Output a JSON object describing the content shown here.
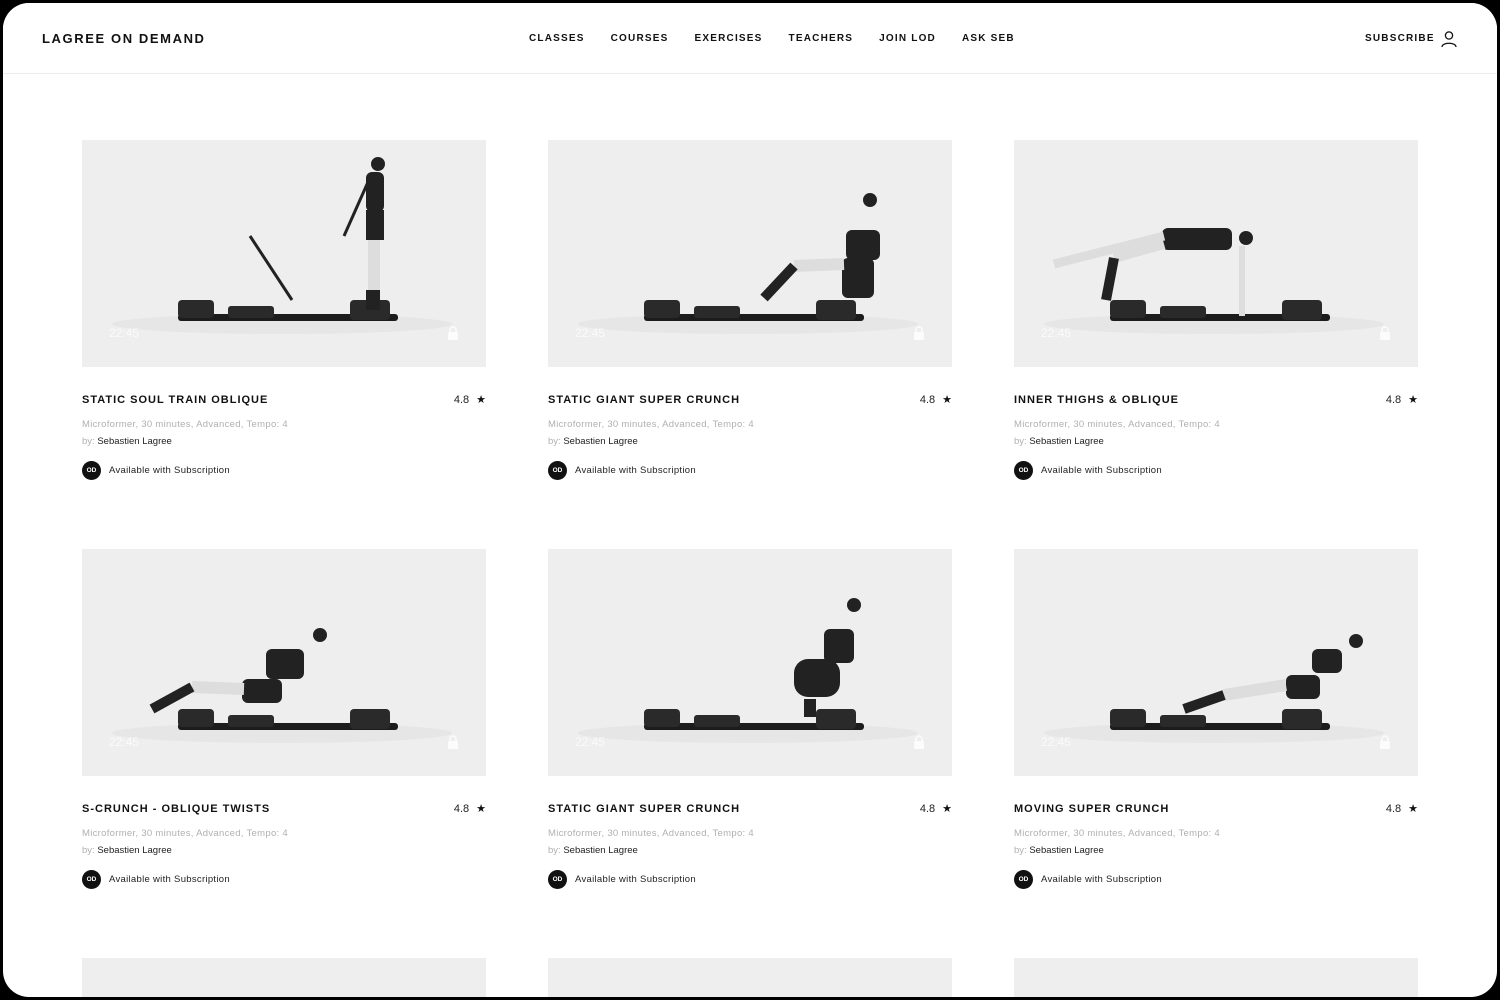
{
  "header": {
    "logo": "LAGREE ON DEMAND",
    "nav": [
      "CLASSES",
      "COURSES",
      "EXERCISES",
      "TEACHERS",
      "JOIN LOD",
      "ASK SEB"
    ],
    "subscribe": "SUBSCRIBE",
    "user_icon": "user-icon"
  },
  "cards": [
    {
      "title": "STATIC SOUL TRAIN OBLIQUE",
      "rating": "4.8",
      "meta": "Microformer, 30 minutes, Advanced, Tempo: 4",
      "by_label": "by:",
      "author": "Sebastien Lagree",
      "badge": "OD",
      "availability": "Available with Subscription",
      "duration": "22:45"
    },
    {
      "title": "STATIC GIANT SUPER CRUNCH",
      "rating": "4.8",
      "meta": "Microformer, 30 minutes, Advanced, Tempo: 4",
      "by_label": "by:",
      "author": "Sebastien Lagree",
      "badge": "OD",
      "availability": "Available with Subscription",
      "duration": "22:45"
    },
    {
      "title": "INNER THIGHS & OBLIQUE",
      "rating": "4.8",
      "meta": "Microformer, 30 minutes, Advanced, Tempo: 4",
      "by_label": "by:",
      "author": "Sebastien Lagree",
      "badge": "OD",
      "availability": "Available with Subscription",
      "duration": "22:45"
    },
    {
      "title": "S-CRUNCH - OBLIQUE TWISTS",
      "rating": "4.8",
      "meta": "Microformer, 30 minutes, Advanced, Tempo: 4",
      "by_label": "by:",
      "author": "Sebastien Lagree",
      "badge": "OD",
      "availability": "Available with Subscription",
      "duration": "22:45"
    },
    {
      "title": "STATIC GIANT SUPER CRUNCH",
      "rating": "4.8",
      "meta": "Microformer, 30 minutes, Advanced, Tempo: 4",
      "by_label": "by:",
      "author": "Sebastien Lagree",
      "badge": "OD",
      "availability": "Available with Subscription",
      "duration": "22:45"
    },
    {
      "title": "MOVING SUPER CRUNCH",
      "rating": "4.8",
      "meta": "Microformer, 30 minutes, Advanced, Tempo: 4",
      "by_label": "by:",
      "author": "Sebastien Lagree",
      "badge": "OD",
      "availability": "Available with Subscription",
      "duration": "22:45"
    }
  ],
  "colors": {
    "accent": "#111111",
    "thumb_bg": "#eeeeee",
    "muted_text": "#b0b0b0"
  }
}
